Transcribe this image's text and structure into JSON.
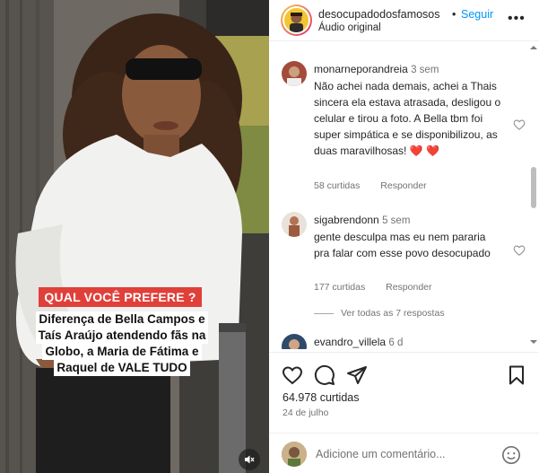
{
  "post": {
    "caption_question": "QUAL VOCÊ PREFERE ?",
    "caption_lines": [
      "Diferença de Bella Campos e",
      "Taís Araújo atendendo fãs na",
      "Globo, a Maria de Fátima e",
      "Raquel de VALE TUDO"
    ],
    "audio_icon": "speaker-muted-icon"
  },
  "header": {
    "username": "desocupadodosfamosos",
    "separator": "•",
    "follow_label": "Seguir",
    "subtitle": "Áudio original",
    "more_label": "•••"
  },
  "comments": [
    {
      "username": "monarneporandreia",
      "time": "3 sem",
      "text": "Não achei nada demais, achei a Thais sincera ela estava atrasada, desligou o celular e tirou a foto. A Bella tbm foi super simpática e se disponibilizou, as duas maravilhosas!",
      "hearts": "❤️ ❤️",
      "likes": "58 curtidas",
      "reply_label": "Responder"
    },
    {
      "username": "sigabrendonn",
      "time": "5 sem",
      "text": "gente desculpa mas eu nem pararia pra falar com esse povo desocupado",
      "likes": "177 curtidas",
      "reply_label": "Responder",
      "view_replies": "Ver todas as 7 respostas"
    },
    {
      "username": "evandro_villela",
      "time": "6 d"
    }
  ],
  "actions": {
    "likes": "64.978 curtidas",
    "date": "24 de julho",
    "icons": [
      "heart-icon",
      "comment-icon",
      "share-icon",
      "save-icon"
    ]
  },
  "add_comment": {
    "placeholder": "Adicione um comentário..."
  },
  "colors": {
    "link_blue": "#0095f6",
    "caption_red": "#e0403a",
    "heart_red": "#ed4956"
  }
}
